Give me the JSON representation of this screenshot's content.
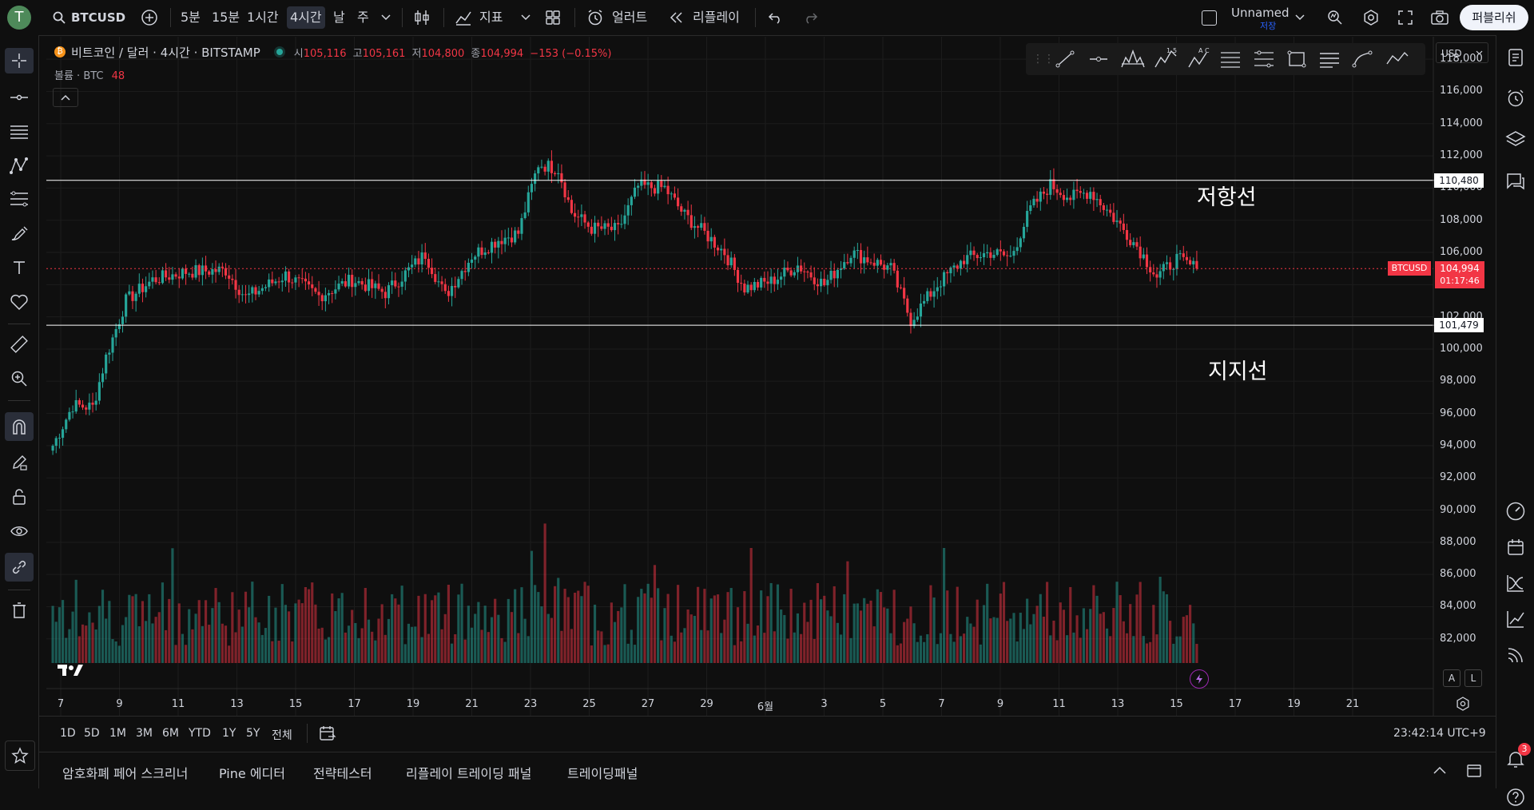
{
  "topbar": {
    "avatar_letter": "T",
    "symbol": "BTCUSD",
    "intervals": [
      "5분",
      "15분",
      "1시간",
      "4시간",
      "날",
      "주"
    ],
    "active_interval": "4시간",
    "indicators_label": "지표",
    "alert_label": "얼러트",
    "replay_label": "리플레이",
    "layout_name": "Unnamed",
    "layout_sub": "저장",
    "publish_label": "퍼블리쉬"
  },
  "legend": {
    "title": "비트코인 / 달러 · 4시간 · BITSTAMP",
    "open_label": "시",
    "open": "105,116",
    "high_label": "고",
    "high": "105,161",
    "low_label": "저",
    "low": "104,800",
    "close_label": "종",
    "close": "104,994",
    "change": "−153 (−0.15%)",
    "volume_label": "볼륨 · BTC",
    "volume_value": "48"
  },
  "currency": "USD",
  "price_tag": {
    "symbol": "BTCUSD",
    "price": "104,994",
    "countdown": "01:17:46"
  },
  "resistance": {
    "label": "저항선",
    "price": 110480,
    "price_text": "110,480"
  },
  "support": {
    "label": "지지선",
    "price": 101479,
    "price_text": "101,479"
  },
  "range_buttons": [
    "1D",
    "5D",
    "1M",
    "3M",
    "6M",
    "YTD",
    "1Y",
    "5Y",
    "전체"
  ],
  "clock": "23:42:14 UTC+9",
  "bottom_tabs": [
    "암호화폐 페어 스크리너",
    "Pine 에디터",
    "전략테스터",
    "리플레이 트레이딩 패널",
    "트레이딩패널"
  ],
  "scale_buttons": [
    "A",
    "L"
  ],
  "notification_count": "3",
  "colors": {
    "up": "#26a69a",
    "down": "#f23645",
    "background": "#0f0f0f"
  },
  "chart_data": {
    "type": "candlestick",
    "y_ticks": [
      82000,
      84000,
      86000,
      88000,
      90000,
      92000,
      94000,
      96000,
      98000,
      100000,
      102000,
      104000,
      106000,
      108000,
      110000,
      112000,
      114000,
      116000,
      118000
    ],
    "y_tick_labels": [
      "82,000",
      "84,000",
      "86,000",
      "88,000",
      "90,000",
      "92,000",
      "94,000",
      "96,000",
      "98,000",
      "100,000",
      "102,000",
      "104,000",
      "106,000",
      "108,000",
      "110,000",
      "112,000",
      "114,000",
      "116,000",
      "118,000"
    ],
    "ylim": [
      80500,
      119000
    ],
    "x_labels": [
      "7",
      "9",
      "11",
      "13",
      "15",
      "17",
      "19",
      "21",
      "23",
      "25",
      "27",
      "29",
      "6월",
      "3",
      "5",
      "7",
      "9",
      "11",
      "13",
      "15",
      "17",
      "19",
      "21"
    ],
    "close_anchors": [
      [
        0,
        94000
      ],
      [
        6,
        96500
      ],
      [
        12,
        96400
      ],
      [
        16,
        99500
      ],
      [
        22,
        103000
      ],
      [
        30,
        104300
      ],
      [
        40,
        104800
      ],
      [
        52,
        104900
      ],
      [
        58,
        103200
      ],
      [
        70,
        104600
      ],
      [
        80,
        103300
      ],
      [
        90,
        104300
      ],
      [
        100,
        103500
      ],
      [
        106,
        104700
      ],
      [
        112,
        105900
      ],
      [
        118,
        103300
      ],
      [
        126,
        105800
      ],
      [
        134,
        106800
      ],
      [
        140,
        107200
      ],
      [
        146,
        111500
      ],
      [
        152,
        111200
      ],
      [
        156,
        108500
      ],
      [
        162,
        107500
      ],
      [
        170,
        107400
      ],
      [
        176,
        110100
      ],
      [
        184,
        110000
      ],
      [
        190,
        108300
      ],
      [
        196,
        107200
      ],
      [
        202,
        106000
      ],
      [
        208,
        103800
      ],
      [
        216,
        104200
      ],
      [
        224,
        105200
      ],
      [
        232,
        104000
      ],
      [
        240,
        106000
      ],
      [
        252,
        105000
      ],
      [
        258,
        101800
      ],
      [
        266,
        104000
      ],
      [
        274,
        105600
      ],
      [
        282,
        106000
      ],
      [
        288,
        105700
      ],
      [
        294,
        108700
      ],
      [
        300,
        110200
      ],
      [
        306,
        109400
      ],
      [
        312,
        109800
      ],
      [
        318,
        108400
      ],
      [
        326,
        106400
      ],
      [
        332,
        104500
      ],
      [
        338,
        105600
      ],
      [
        344,
        104994
      ]
    ],
    "volume_max_btc": 2600
  }
}
